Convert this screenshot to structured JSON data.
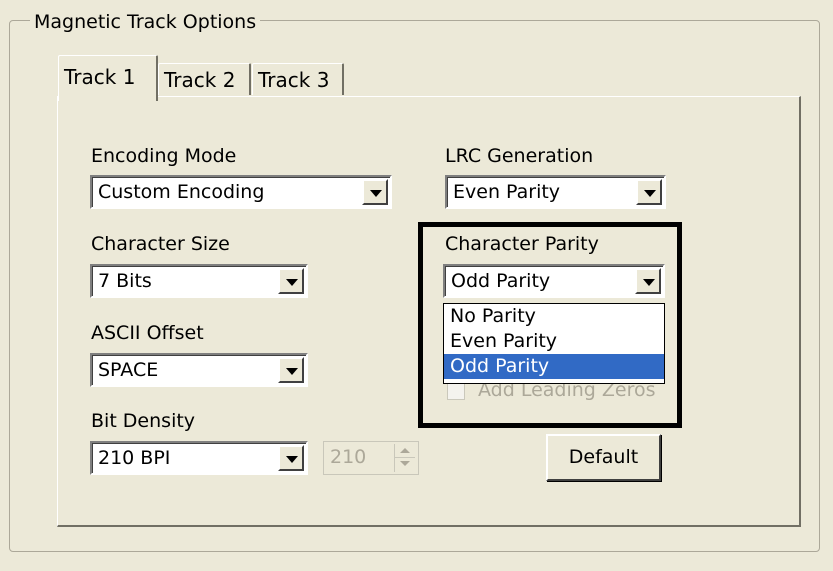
{
  "group": {
    "title": "Magnetic Track Options"
  },
  "tabs": [
    "Track 1",
    "Track 2",
    "Track 3"
  ],
  "active_tab": "Track 1",
  "fields": {
    "encoding_mode": {
      "label": "Encoding Mode",
      "value": "Custom Encoding"
    },
    "character_size": {
      "label": "Character Size",
      "value": "7 Bits"
    },
    "ascii_offset": {
      "label": "ASCII Offset",
      "value": "SPACE"
    },
    "bit_density": {
      "label": "Bit Density",
      "value": "210 BPI"
    },
    "bit_density_custom": {
      "value": "210",
      "enabled": false
    },
    "lrc_generation": {
      "label": "LRC Generation",
      "value": "Even Parity"
    },
    "character_parity": {
      "label": "Character Parity",
      "value": "Odd Parity",
      "open": true,
      "options": [
        "No Parity",
        "Even Parity",
        "Odd Parity"
      ],
      "selected_option": "Odd Parity"
    },
    "add_leading_zeros": {
      "label": "Add Leading Zeros",
      "checked": false,
      "enabled": false
    }
  },
  "buttons": {
    "default": "Default"
  },
  "colors": {
    "selection": "#316ac5",
    "dialog_bg": "#ece9d8",
    "highlight_border": "#000000"
  }
}
